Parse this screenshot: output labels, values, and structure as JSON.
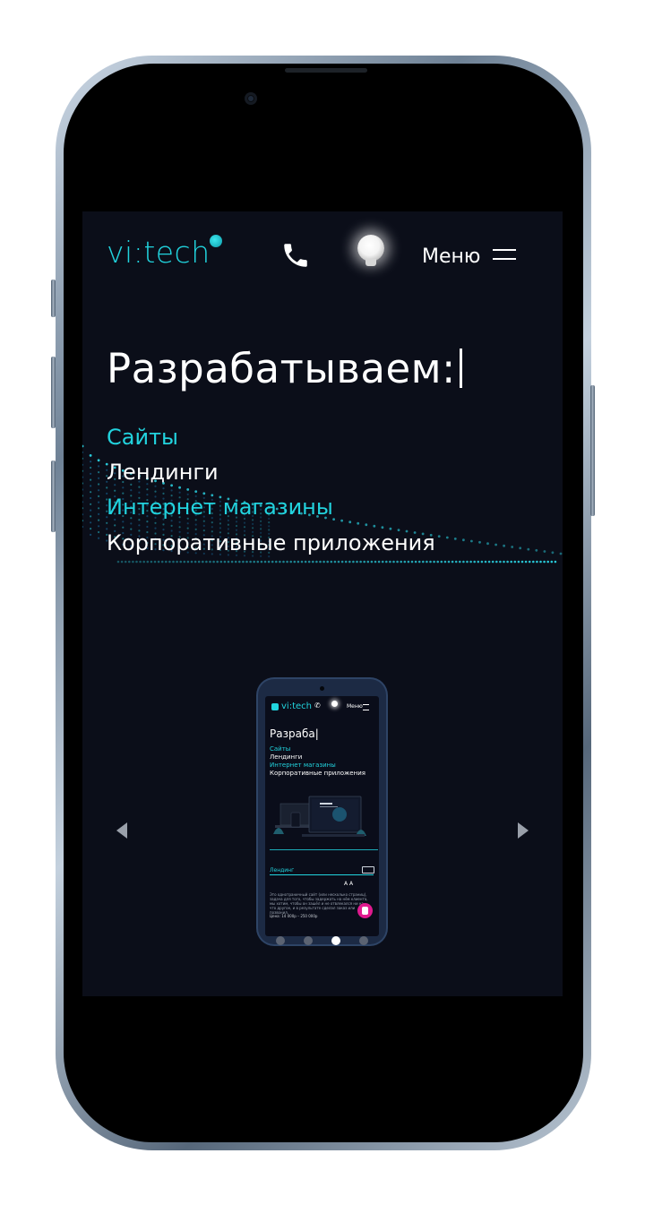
{
  "header": {
    "logo": "vi:tech",
    "menu_label": "Меню"
  },
  "hero": {
    "headline": "Разрабатываем:",
    "items": [
      {
        "label": "Сайты",
        "color": "#22d3de"
      },
      {
        "label": "Лендинги",
        "color": "#ffffff"
      },
      {
        "label": "Интернет магазины",
        "color": "#22d3de"
      },
      {
        "label": "Корпоративные приложения",
        "color": "#ffffff"
      }
    ]
  },
  "carousel": {
    "preview": {
      "logo": "vi:tech",
      "menu_label": "Меню",
      "headline": "Разраба|",
      "items": [
        "Сайты",
        "Лендинги",
        "Интернет магазины",
        "Корпоративные приложения"
      ],
      "section_label": "Лендинг",
      "icons_text": "A  A",
      "description": "Это однотраничный сайт (или несколько страниц), задача для того, чтобы задержать на нём клиента, мы хотим, чтобы он зашёл и не отвлекался ни на что другое, и в результате сделал заказ или позвонил.",
      "price": "Цена: 14 000р – 250 000р"
    },
    "slides_count": 4,
    "active_slide_index": 2
  },
  "colors": {
    "accent": "#22d3de",
    "screen_bg": "#0b0e19",
    "badge": "#e01a8f"
  },
  "icons": {
    "phone": "phone-icon",
    "theme": "light-bulb-icon",
    "menu": "hamburger-icon",
    "prev": "chevron-left-icon",
    "next": "chevron-right-icon"
  }
}
